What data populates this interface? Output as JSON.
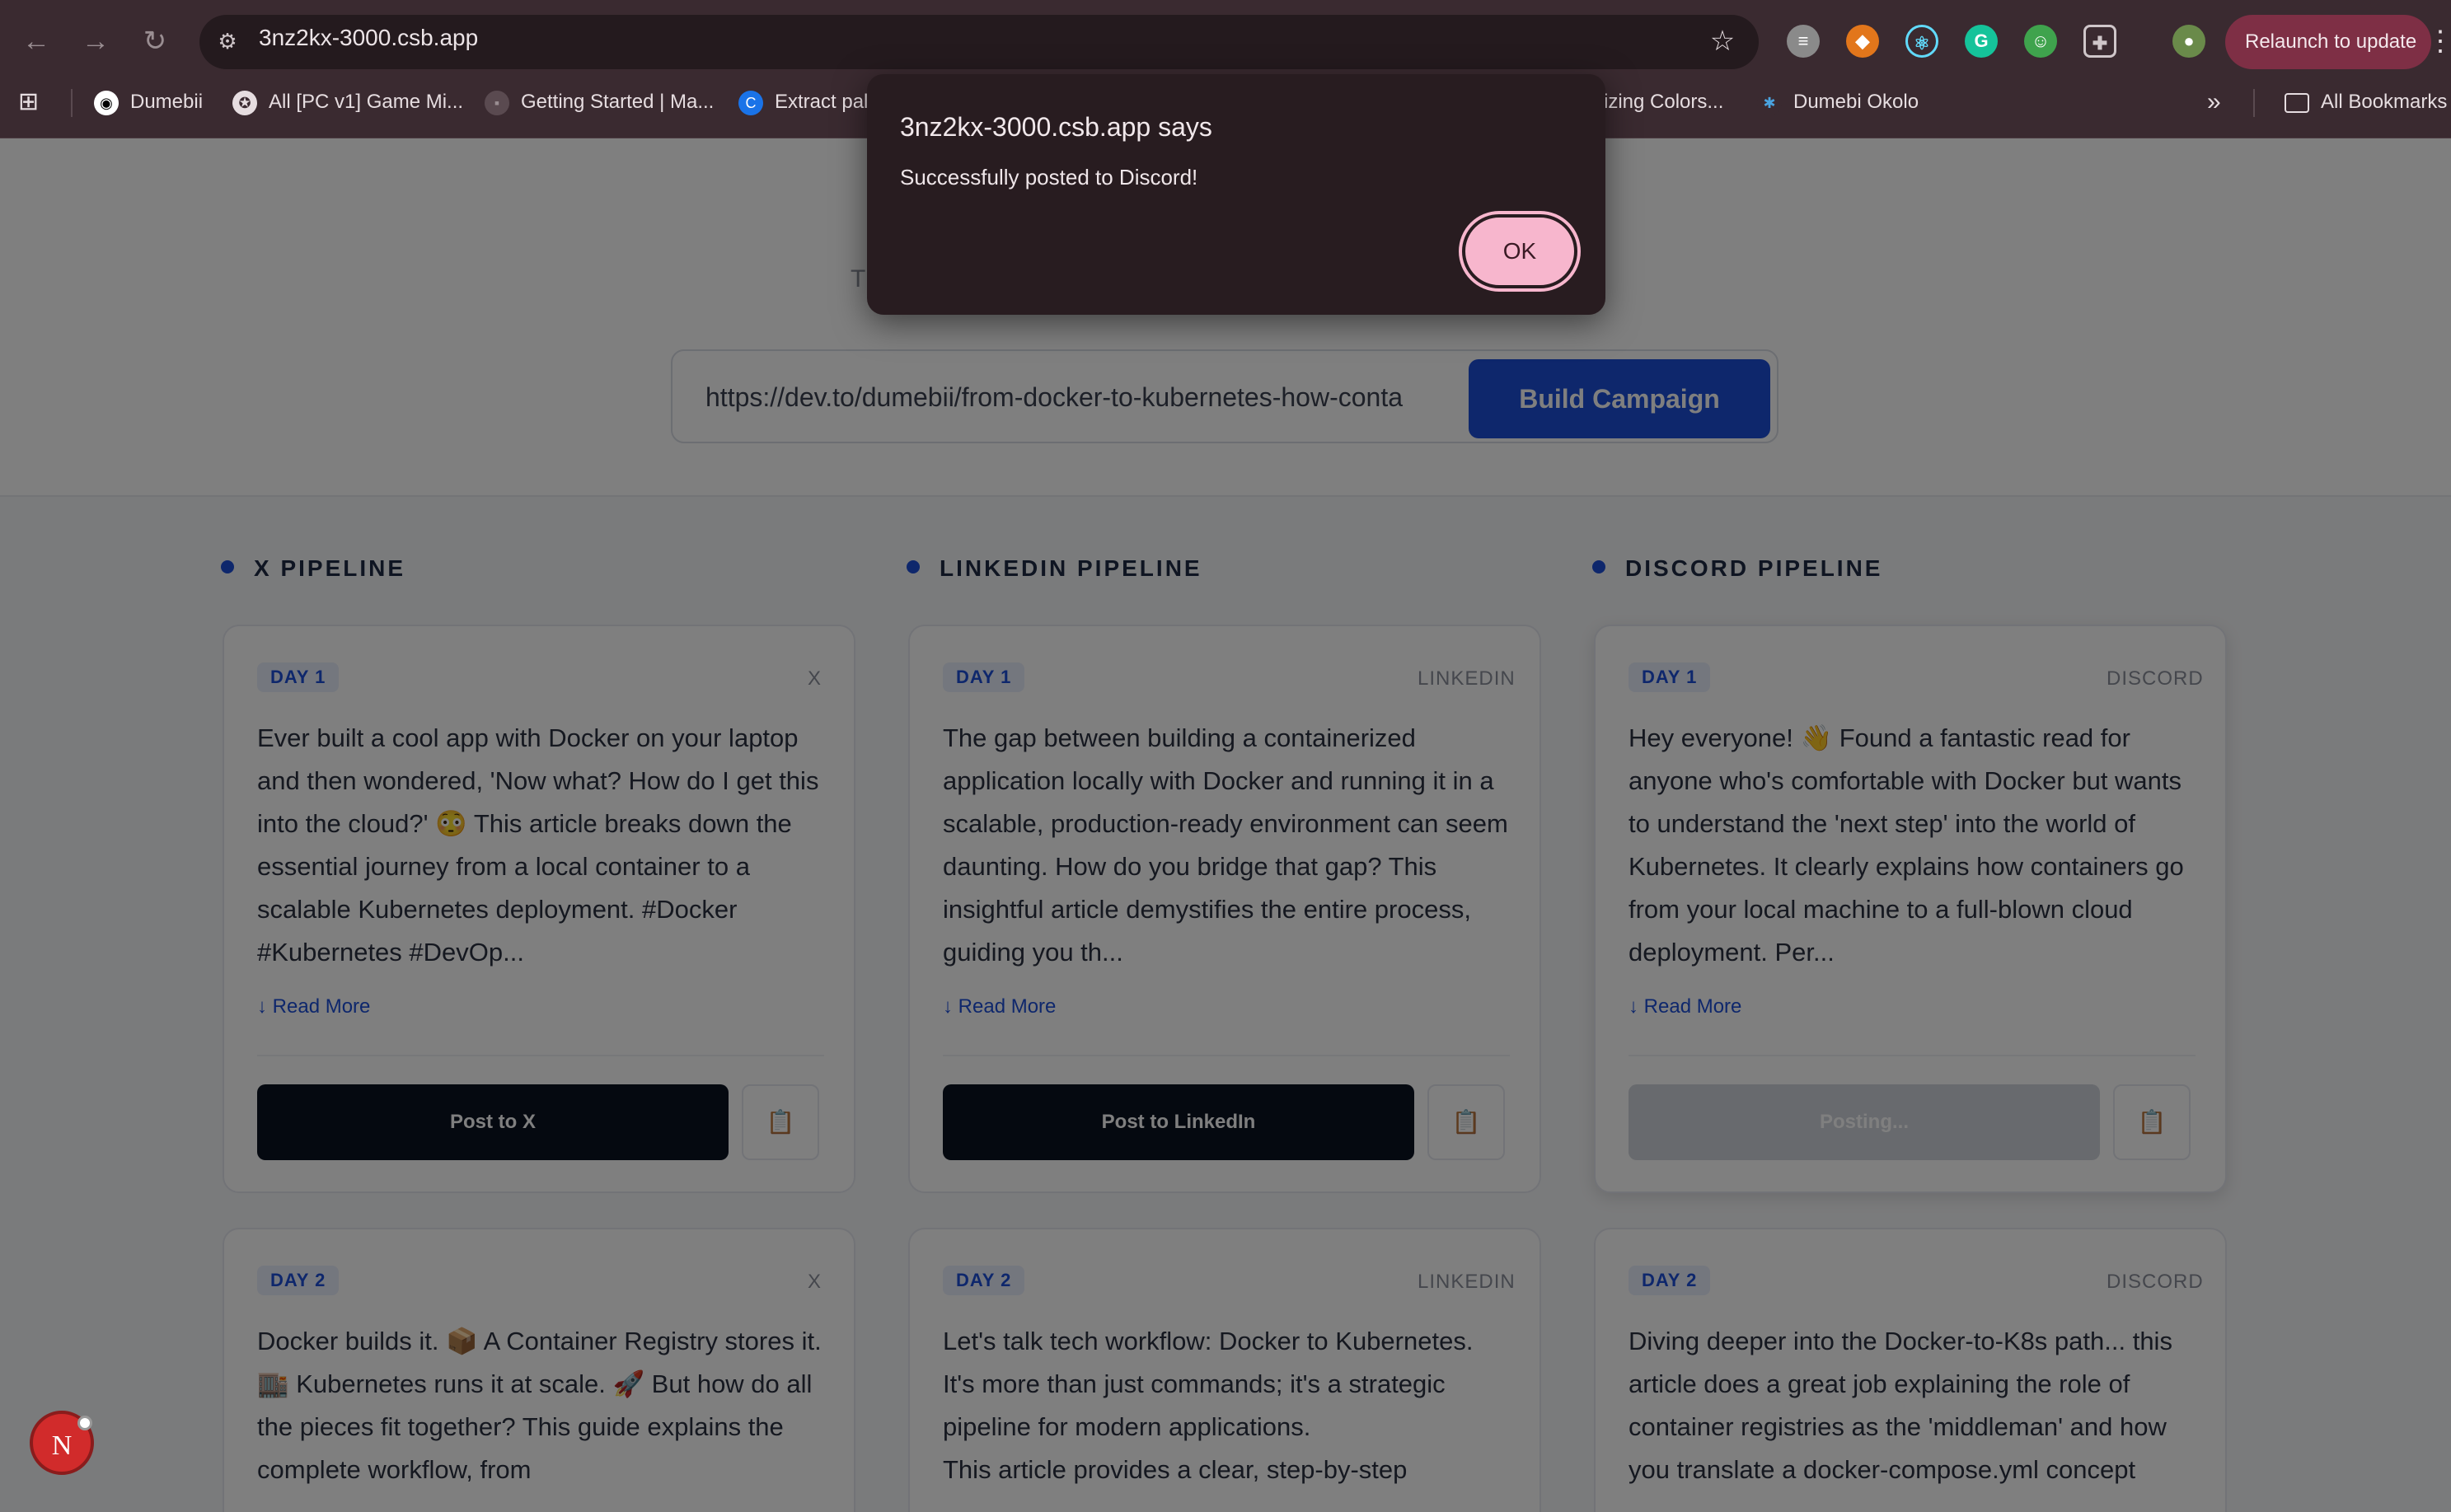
{
  "browser": {
    "url": "3nz2kx-3000.csb.app",
    "relaunch_label": "Relaunch to update",
    "bookmarks": [
      {
        "label": "Dumebii"
      },
      {
        "label": "All [PC v1] Game Mi..."
      },
      {
        "label": "Getting Started | Ma..."
      },
      {
        "label": "Extract pal"
      },
      {
        "label": "izing Colors..."
      },
      {
        "label": "Dumebi Okolo"
      }
    ],
    "all_bookmarks_label": "All Bookmarks"
  },
  "dialog": {
    "title": "3nz2kx-3000.csb.app says",
    "message": "Successfully posted to Discord!",
    "ok_label": "OK"
  },
  "hero": {
    "subtitle_fragment": "T",
    "url_value": "https://dev.to/dumebii/from-docker-to-kubernetes-how-conta",
    "build_label": "Build Campaign"
  },
  "columns": [
    {
      "title": "X PIPELINE",
      "cards": [
        {
          "day": "DAY 1",
          "platform": "X",
          "text": "Ever built a cool app with Docker on your laptop and then wondered, 'Now what? How do I get this into the cloud?' 😳 This article breaks down the essential journey from a local container to a scalable Kubernetes deployment. #Docker #Kubernetes #DevOp...",
          "read_more": "↓ Read More",
          "post_label": "Post to X"
        },
        {
          "day": "DAY 2",
          "platform": "X",
          "text": "Docker builds it. 📦 A Container Registry stores it. 🏬 Kubernetes runs it at scale. 🚀 But how do all the pieces fit together? This guide explains the complete workflow, from"
        }
      ]
    },
    {
      "title": "LINKEDIN PIPELINE",
      "cards": [
        {
          "day": "DAY 1",
          "platform": "LINKEDIN",
          "text": "The gap between building a containerized application locally with Docker and running it in a scalable, production-ready environment can seem daunting. How do you bridge that gap? This insightful article demystifies the entire process, guiding you th...",
          "read_more": "↓ Read More",
          "post_label": "Post to LinkedIn"
        },
        {
          "day": "DAY 2",
          "platform": "LINKEDIN",
          "text": "Let's talk tech workflow: Docker to Kubernetes. It's more than just commands; it's a strategic pipeline for modern applications.\nThis article provides a clear, step-by-step"
        }
      ]
    },
    {
      "title": "DISCORD PIPELINE",
      "cards": [
        {
          "day": "DAY 1",
          "platform": "DISCORD",
          "text": "Hey everyone! 👋 Found a fantastic read for anyone who's comfortable with Docker but wants to understand the 'next step' into the world of Kubernetes. It clearly explains how containers go from your local machine to a full-blown cloud deployment. Per...",
          "read_more": "↓ Read More",
          "post_label": "Posting..."
        },
        {
          "day": "DAY 2",
          "platform": "DISCORD",
          "text": "Diving deeper into the Docker-to-K8s path... this article does a great job explaining the role of container registries as the 'middleman' and how you translate a docker-compose.yml concept"
        }
      ]
    }
  ],
  "floating_avatar_letter": "N",
  "colors": {
    "accent": "#1d4ed8",
    "post_button": "#0b1220",
    "dialog_bg": "#281c20",
    "ok_button": "#f7b6cd",
    "chrome_bg": "#3a2a30"
  }
}
